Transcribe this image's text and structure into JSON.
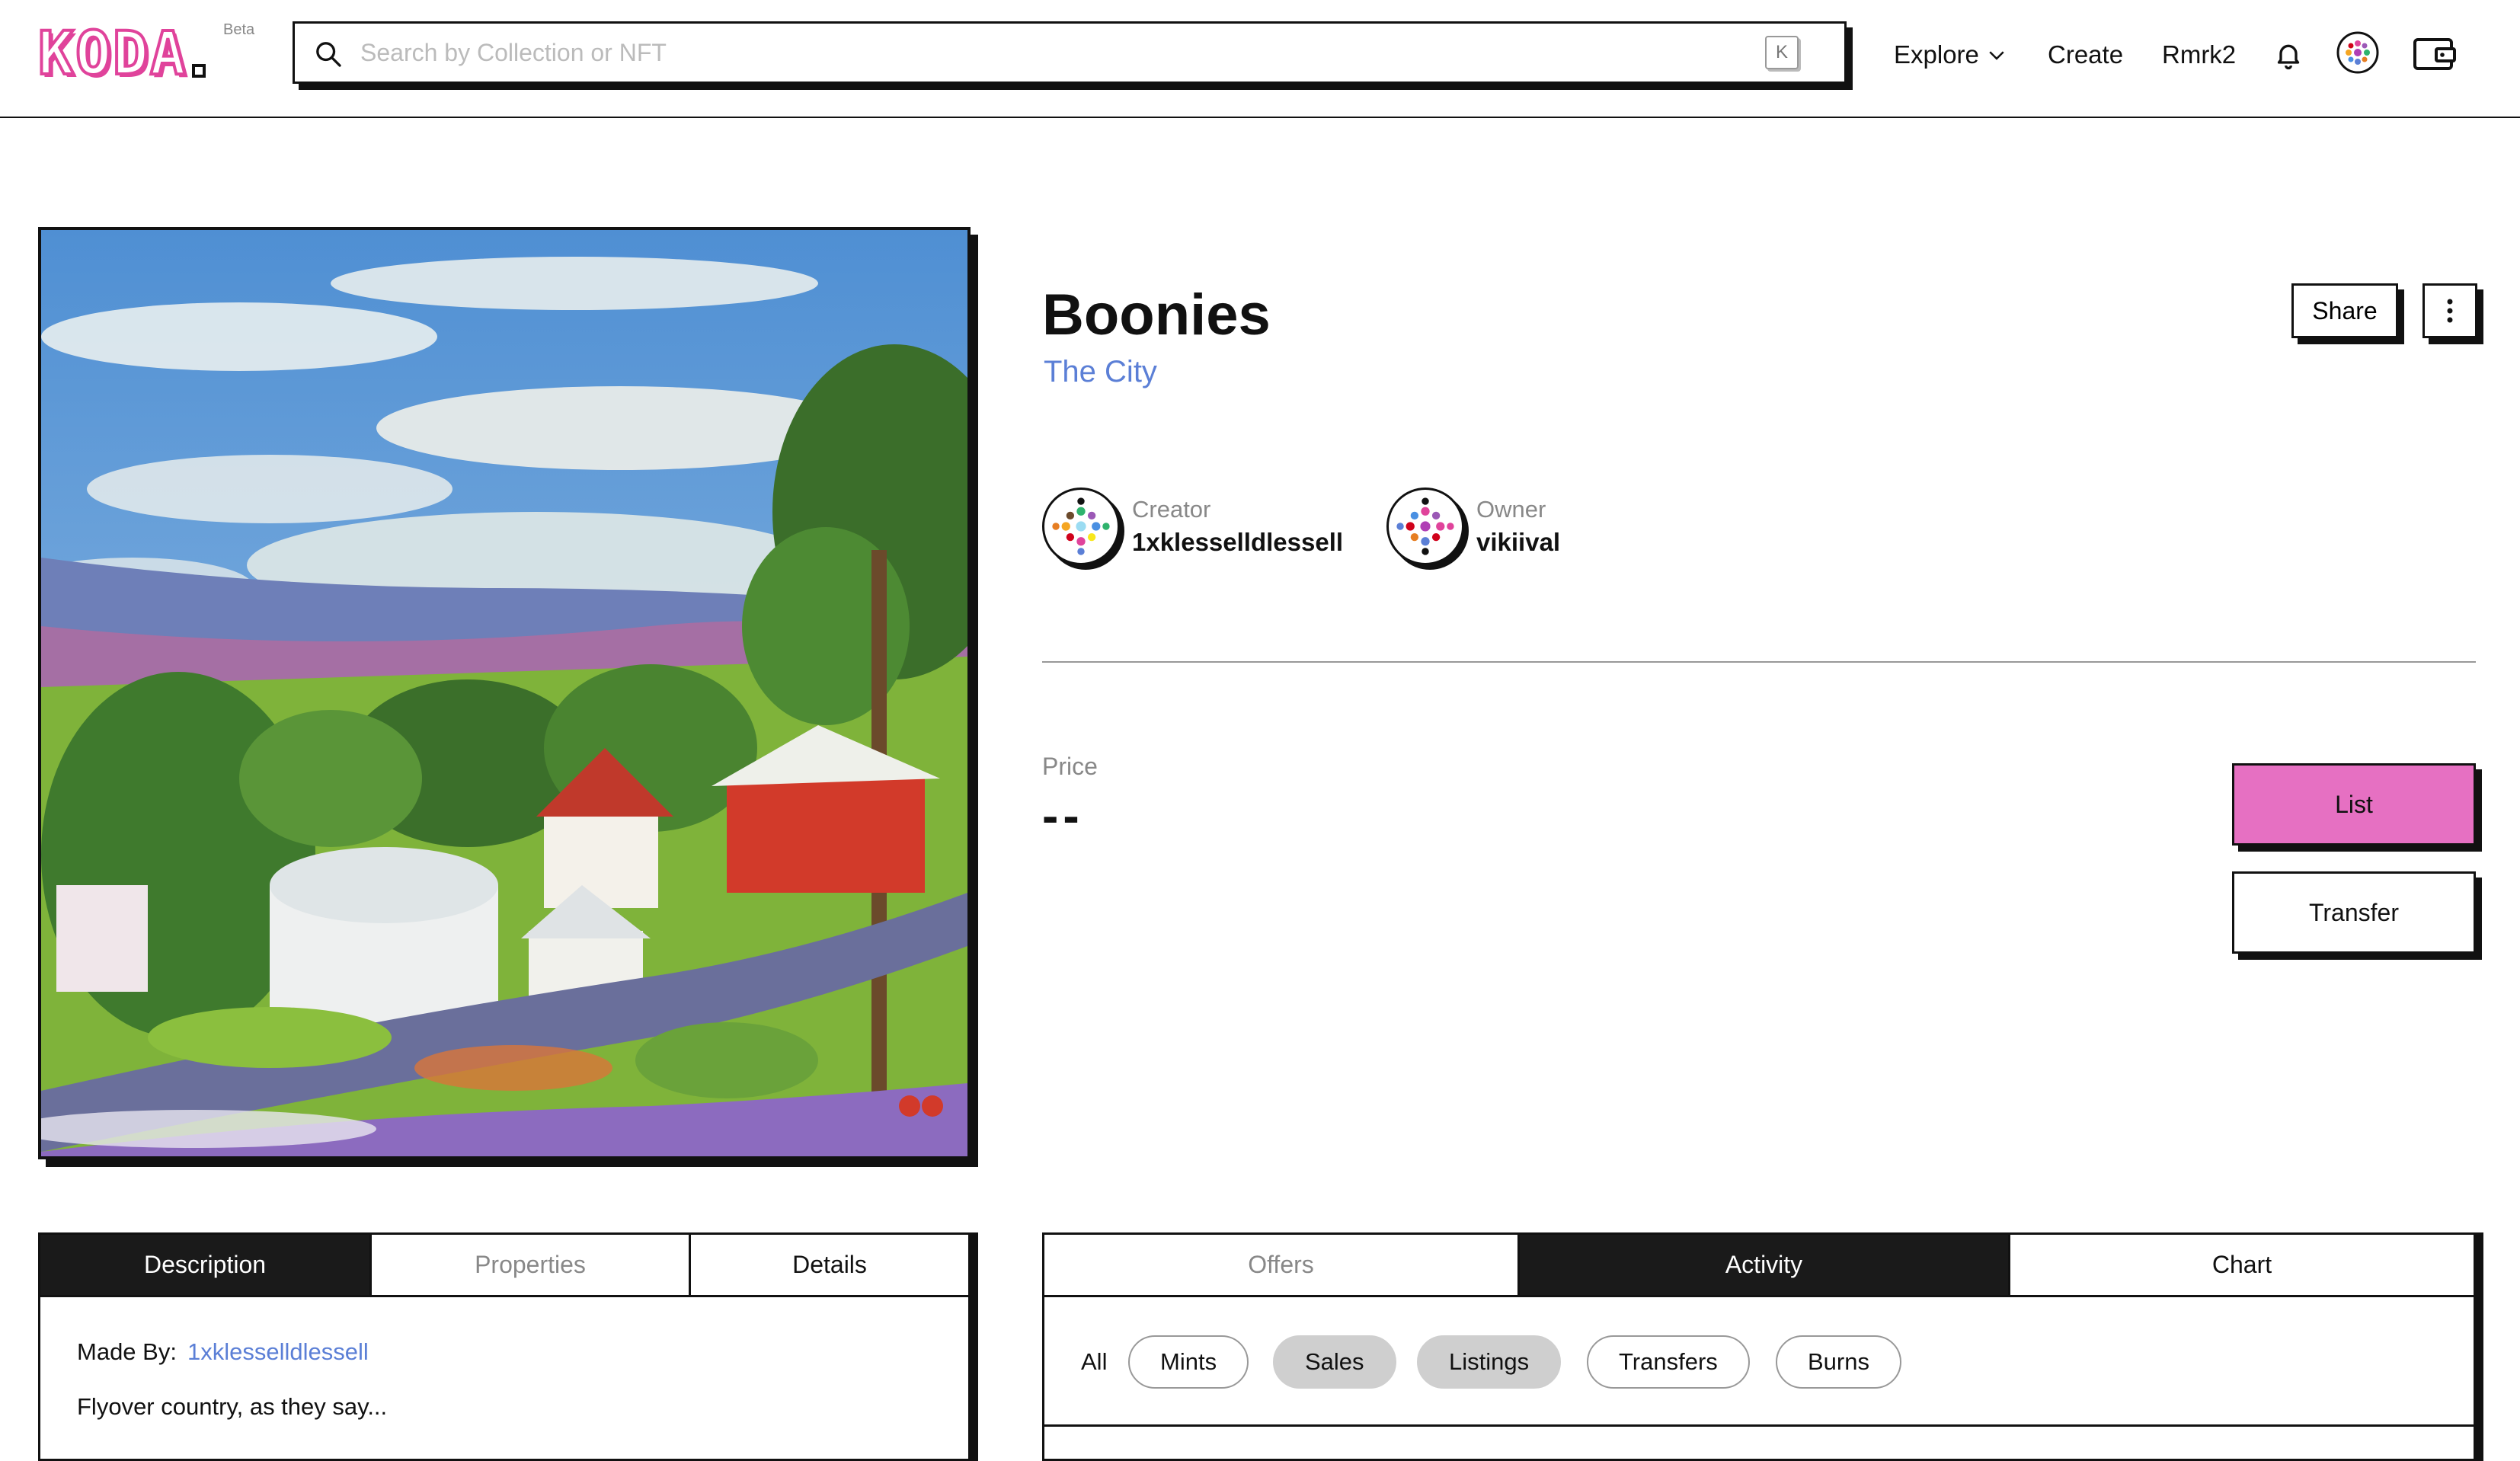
{
  "header": {
    "logo": "KODA",
    "beta": "Beta",
    "search_placeholder": "Search by Collection or NFT",
    "search_shortcut": "K",
    "nav": {
      "explore": "Explore",
      "create": "Create",
      "rmrk": "Rmrk2"
    }
  },
  "nft": {
    "title": "Boonies",
    "collection": "The City",
    "share": "Share",
    "creator": {
      "role": "Creator",
      "name": "1xklesselldlessell"
    },
    "owner": {
      "role": "Owner",
      "name": "vikiival"
    },
    "price_label": "Price",
    "price_value": "--",
    "list": "List",
    "transfer": "Transfer"
  },
  "description_panel": {
    "tabs": [
      "Description",
      "Properties",
      "Details"
    ],
    "made_by_label": "Made By:",
    "made_by_value": "1xklesselldlessell",
    "text": "Flyover country, as they say..."
  },
  "activity_panel": {
    "tabs": [
      "Offers",
      "Activity",
      "Chart"
    ],
    "all": "All",
    "filters": [
      "Mints",
      "Sales",
      "Listings",
      "Transfers",
      "Burns"
    ]
  },
  "colors": {
    "accent_pink": "#e670c2",
    "link_blue": "#5b7fd6",
    "active_tab": "#1a1a1a"
  }
}
